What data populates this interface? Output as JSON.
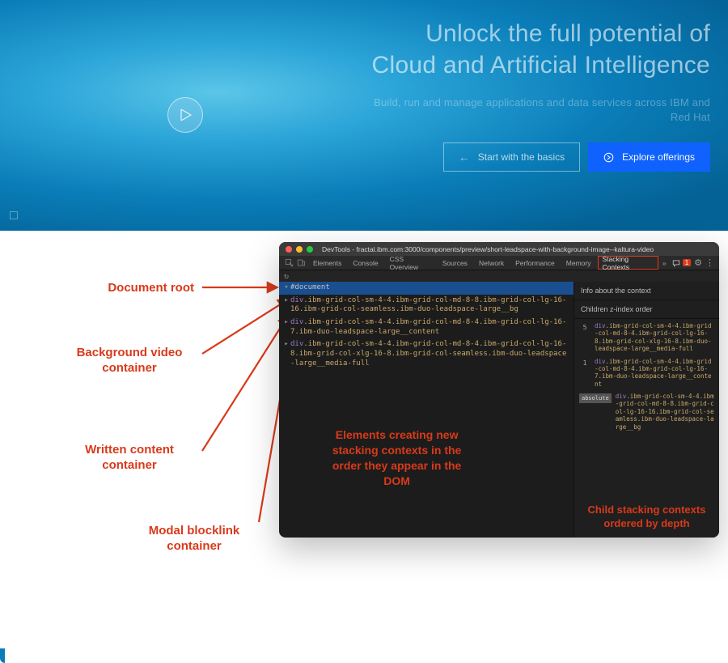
{
  "hero": {
    "title": "Unlock the full potential of Cloud and Artificial Intelligence",
    "subtitle": "Build, run and manage applications and data services across IBM and Red Hat",
    "cta_secondary": "Start with the basics",
    "cta_primary": "Explore offerings"
  },
  "annotations": {
    "doc_root": "Document root",
    "bg_video": "Background video container",
    "written": "Written content container",
    "modal": "Modal blocklink container",
    "left_caption": "Elements creating new stacking contexts in the order they appear in the DOM",
    "right_caption": "Child stacking contexts ordered by depth"
  },
  "devtools": {
    "window_title": "DevTools - fractal.ibm.com:3000/components/preview/short-leadspace-with-background-image--kaltura-video",
    "tabs": [
      "Elements",
      "Console",
      "CSS Overview",
      "Sources",
      "Network",
      "Performance",
      "Memory",
      "Stacking Contexts"
    ],
    "active_tab_index": 7,
    "more_glyph": "»",
    "bug_count": "1",
    "left_panel": {
      "document_label": "#document",
      "nodes": [
        {
          "tag": "div",
          "classes": ".ibm-grid-col-sm-4-4.ibm-grid-col-md-8-8.ibm-grid-col-lg-16-16.ibm-grid-col-seamless.ibm-duo-leadspace-large__bg"
        },
        {
          "tag": "div",
          "classes": ".ibm-grid-col-sm-4-4.ibm-grid-col-md-8-4.ibm-grid-col-lg-16-7.ibm-duo-leadspace-large__content"
        },
        {
          "tag": "div",
          "classes": ".ibm-grid-col-sm-4-4.ibm-grid-col-md-8-4.ibm-grid-col-lg-16-8.ibm-grid-col-xlg-16-8.ibm-grid-col-seamless.ibm-duo-leadspace-large__media-full"
        }
      ]
    },
    "right_panel": {
      "info_title": "Info about the context",
      "children_title": "Children z-index order",
      "items": [
        {
          "z": "5",
          "tag": "div",
          "classes": ".ibm-grid-col-sm-4-4.ibm-grid-col-md-8-4.ibm-grid-col-lg-16-8.ibm-grid-col-xlg-16-8.ibm-duo-leadspace-large__media-full"
        },
        {
          "z": "1",
          "tag": "div",
          "classes": ".ibm-grid-col-sm-4-4.ibm-grid-col-md-8-4.ibm-grid-col-lg-16-7.ibm-duo-leadspace-large__content"
        },
        {
          "z": "absolute",
          "tag": "div",
          "classes": ".ibm-grid-col-sm-4-4.ibm-grid-col-md-8-8.ibm-grid-col-lg-16-16.ibm-grid-col-seamless.ibm-duo-leadspace-large__bg"
        }
      ]
    }
  }
}
